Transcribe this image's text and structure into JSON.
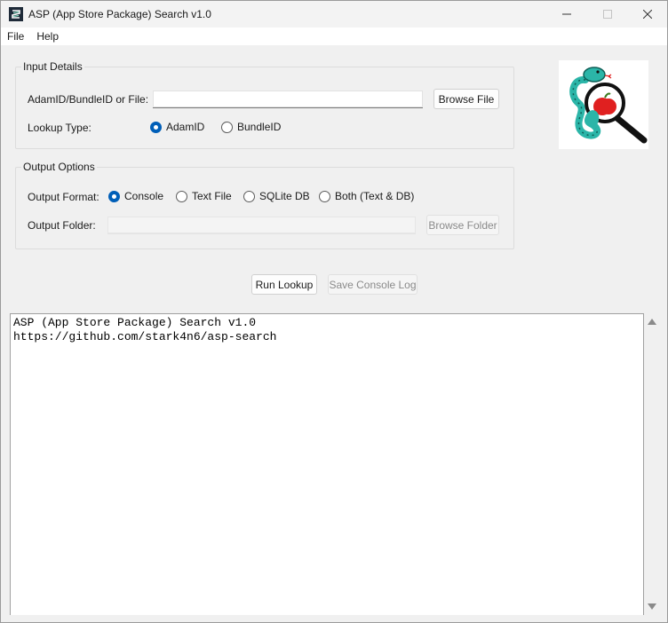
{
  "window": {
    "title": "ASP (App Store Package) Search v1.0",
    "minimize": "—",
    "maximize": "☐",
    "close": "✕"
  },
  "menu": {
    "items": [
      "File",
      "Help"
    ]
  },
  "input_details": {
    "group_title": "Input Details",
    "id_label": "AdamID/BundleID or File:",
    "id_value": "",
    "browse_file": "Browse File",
    "lookup_label": "Lookup Type:",
    "lookup_options": [
      "AdamID",
      "BundleID"
    ],
    "lookup_selected": "AdamID"
  },
  "output_options": {
    "group_title": "Output Options",
    "format_label": "Output Format:",
    "format_options": [
      "Console",
      "Text File",
      "SQLite DB",
      "Both (Text & DB)"
    ],
    "format_selected": "Console",
    "folder_label": "Output Folder:",
    "folder_value": "",
    "browse_folder": "Browse Folder"
  },
  "actions": {
    "run_lookup": "Run Lookup",
    "save_console_log": "Save Console Log"
  },
  "console": {
    "lines": [
      "ASP (App Store Package) Search v1.0",
      "https://github.com/stark4n6/asp-search"
    ]
  },
  "logo": {
    "icon": "snake-apple-magnifier-logo",
    "colors": {
      "snake": "#2bb5a8",
      "apple": "#e02020",
      "lens": "#111111"
    }
  },
  "colors": {
    "accent": "#005fb8"
  }
}
